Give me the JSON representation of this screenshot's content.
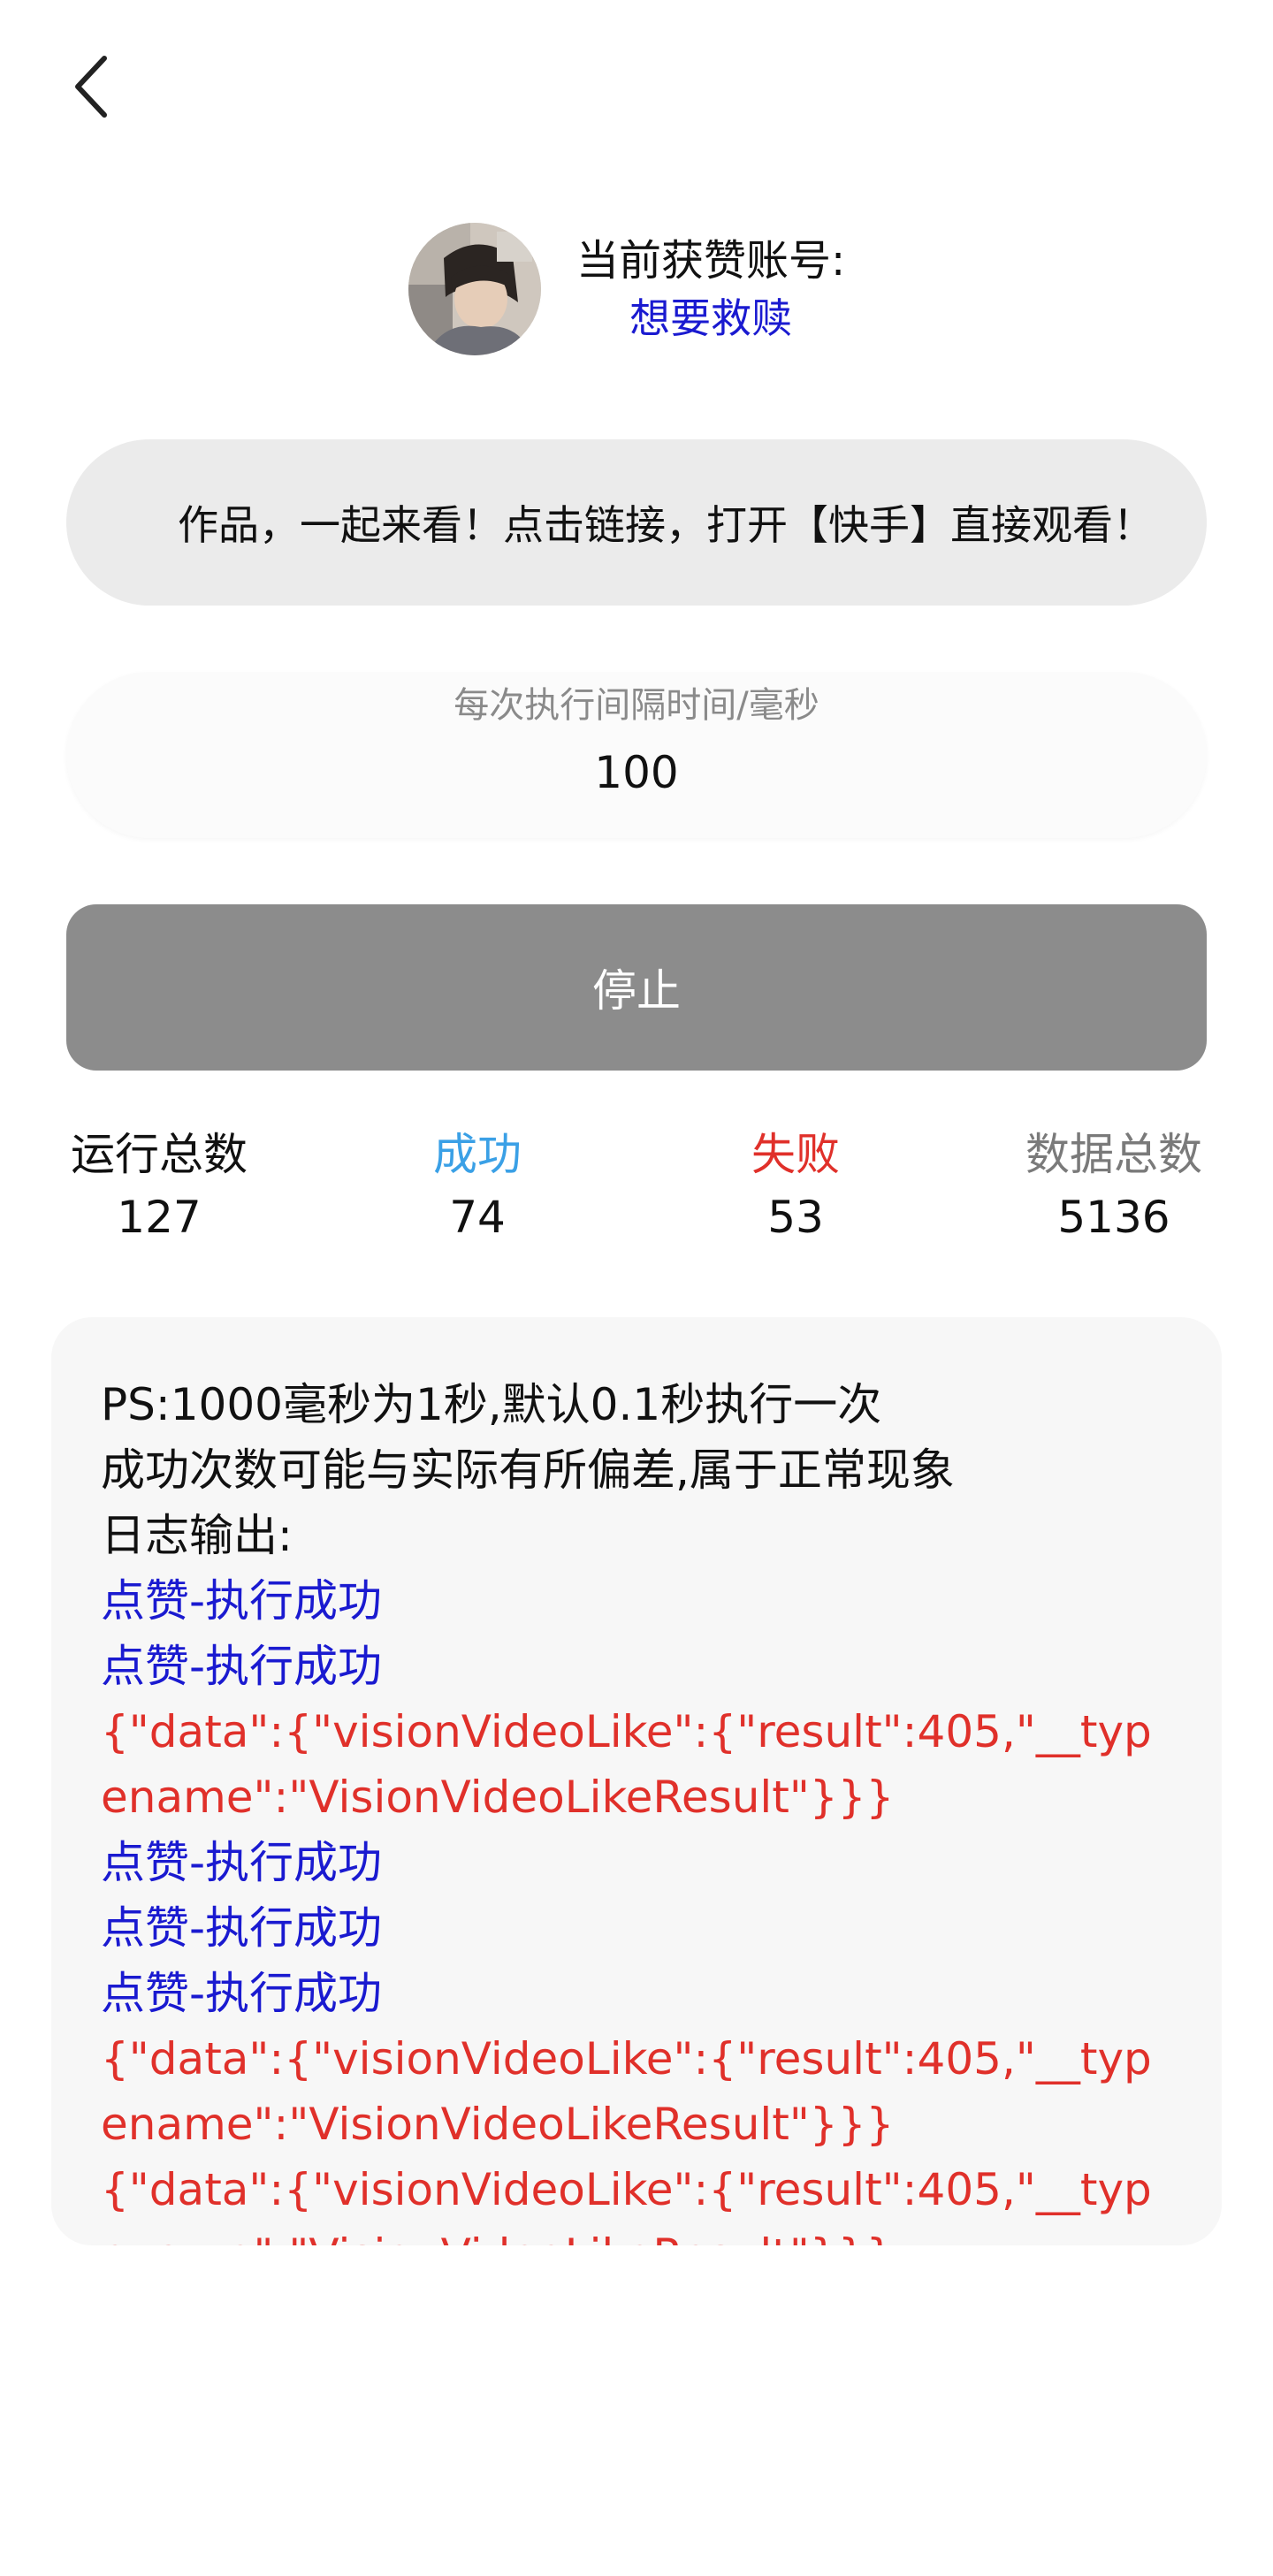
{
  "colors": {
    "account_name": "#1a1ad0",
    "success": "#3aa0e6",
    "fail": "#e0302a",
    "total_data_label": "#7a7a7a",
    "log_success": "#1a1ad0",
    "log_error": "#e0302a",
    "stop_button_bg": "#8c8c8c"
  },
  "header": {
    "back_icon": "chevron-left-icon"
  },
  "account": {
    "title": "当前获赞账号:",
    "name": "想要救赎"
  },
  "link_input": {
    "value": "作品，一起来看！点击链接，打开【快手】直接观看！"
  },
  "interval": {
    "label": "每次执行间隔时间/毫秒",
    "value": "100"
  },
  "stop_button": {
    "label": "停止"
  },
  "stats": {
    "total_runs": {
      "label": "运行总数",
      "value": "127"
    },
    "success": {
      "label": "成功",
      "value": "74"
    },
    "fail": {
      "label": "失败",
      "value": "53"
    },
    "total_data": {
      "label": "数据总数",
      "value": "5136"
    }
  },
  "log": {
    "notes": [
      "PS:1000毫秒为1秒,默认0.1秒执行一次",
      "成功次数可能与实际有所偏差,属于正常现象",
      "日志输出:"
    ],
    "entries": [
      {
        "type": "success",
        "text": "点赞-执行成功"
      },
      {
        "type": "success",
        "text": "点赞-执行成功"
      },
      {
        "type": "error",
        "text": "{\"data\":{\"visionVideoLike\":{\"result\":405,\"__typename\":\"VisionVideoLikeResult\"}}}"
      },
      {
        "type": "success",
        "text": "点赞-执行成功"
      },
      {
        "type": "success",
        "text": "点赞-执行成功"
      },
      {
        "type": "success",
        "text": "点赞-执行成功"
      },
      {
        "type": "error",
        "text": "{\"data\":{\"visionVideoLike\":{\"result\":405,\"__typename\":\"VisionVideoLikeResult\"}}}"
      },
      {
        "type": "error",
        "text": "{\"data\":{\"visionVideoLike\":{\"result\":405,\"__typename\":\"VisionVideoLikeResult\"}}}"
      }
    ]
  }
}
